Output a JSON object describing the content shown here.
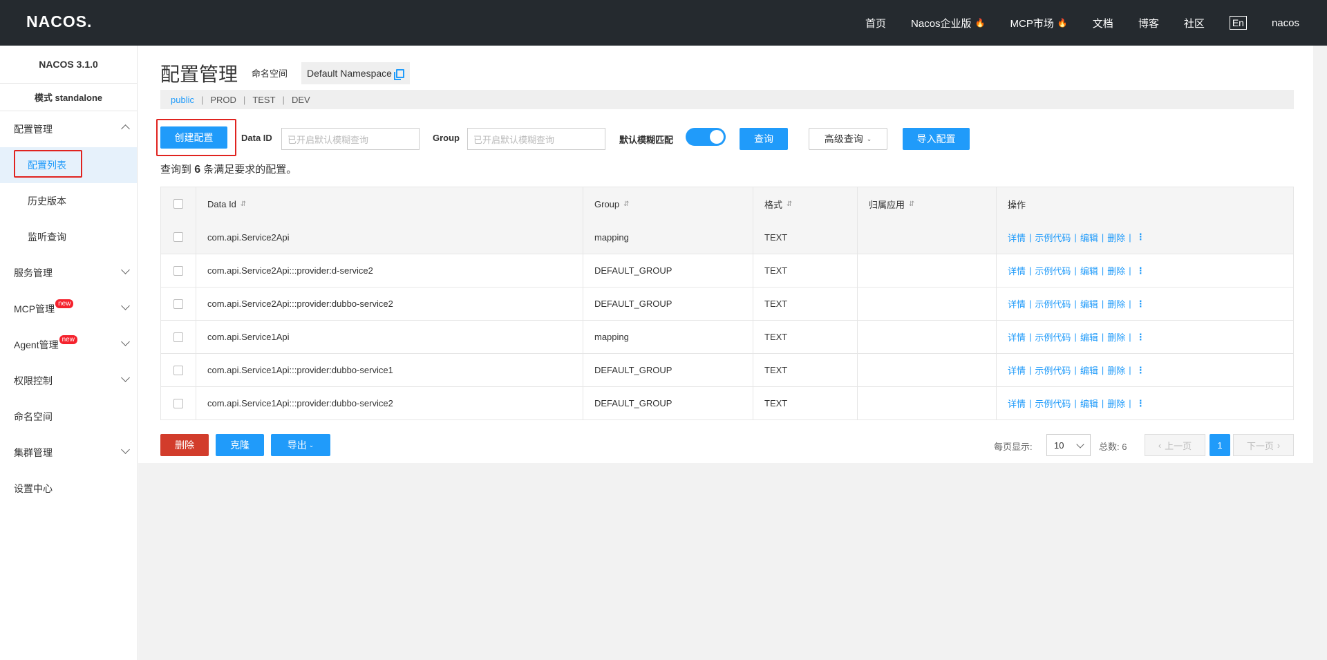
{
  "topbar": {
    "logo": "NACOS.",
    "nav": [
      "首页",
      "Nacos企业版",
      "MCP市场",
      "文档",
      "博客",
      "社区"
    ],
    "lang": "En",
    "user": "nacos"
  },
  "sidebar": {
    "version": "NACOS 3.1.0",
    "mode": "模式 standalone",
    "config_menu": "配置管理",
    "sub": [
      "配置列表",
      "历史版本",
      "监听查询"
    ],
    "service_menu": "服务管理",
    "mcp_menu": "MCP管理",
    "agent_menu": "Agent管理",
    "badge_new": "new",
    "auth_menu": "权限控制",
    "namespace_menu": "命名空间",
    "cluster_menu": "集群管理",
    "settings_menu": "设置中心"
  },
  "header": {
    "title": "配置管理",
    "ns_label": "命名空间",
    "ns_value": "Default Namespace"
  },
  "tabs": [
    "public",
    "PROD",
    "TEST",
    "DEV"
  ],
  "search": {
    "create_btn": "创建配置",
    "dataid_label": "Data ID",
    "dataid_placeholder": "已开启默认模糊查询",
    "group_label": "Group",
    "group_placeholder": "已开启默认模糊查询",
    "fuzzy_label": "默认模糊匹配",
    "fuzzy_on": true,
    "query_btn": "查询",
    "advanced_btn": "高级查询",
    "import_btn": "导入配置"
  },
  "summary": {
    "prefix": "查询到",
    "count": "6",
    "suffix": "条满足要求的配置。"
  },
  "table": {
    "headers": [
      "Data Id",
      "Group",
      "格式",
      "归属应用",
      "操作"
    ],
    "rows": [
      {
        "dataid": "com.api.Service2Api",
        "group": "mapping",
        "format": "TEXT",
        "app": ""
      },
      {
        "dataid": "com.api.Service2Api:::provider:d-service2",
        "group": "DEFAULT_GROUP",
        "format": "TEXT",
        "app": ""
      },
      {
        "dataid": "com.api.Service2Api:::provider:dubbo-service2",
        "group": "DEFAULT_GROUP",
        "format": "TEXT",
        "app": ""
      },
      {
        "dataid": "com.api.Service1Api",
        "group": "mapping",
        "format": "TEXT",
        "app": ""
      },
      {
        "dataid": "com.api.Service1Api:::provider:dubbo-service1",
        "group": "DEFAULT_GROUP",
        "format": "TEXT",
        "app": ""
      },
      {
        "dataid": "com.api.Service1Api:::provider:dubbo-service2",
        "group": "DEFAULT_GROUP",
        "format": "TEXT",
        "app": ""
      }
    ],
    "ops": [
      "详情",
      "示例代码",
      "编辑",
      "删除"
    ]
  },
  "footer": {
    "delete_btn": "删除",
    "clone_btn": "克隆",
    "export_btn": "导出",
    "page_size_label": "每页显示:",
    "page_size": "10",
    "total_label": "总数: 6",
    "prev": "上一页",
    "page": "1",
    "next": "下一页"
  }
}
